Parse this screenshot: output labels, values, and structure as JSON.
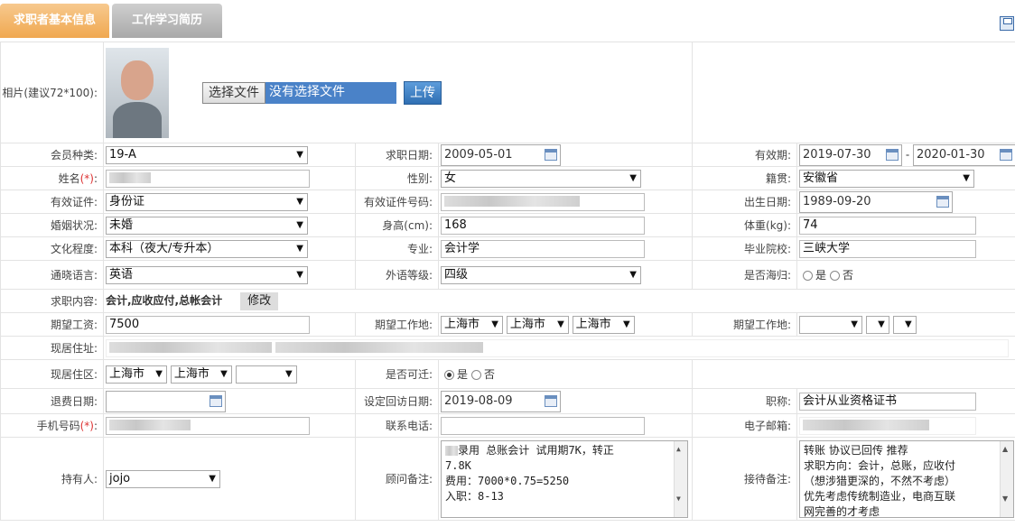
{
  "tabs": [
    {
      "label": "求职者基本信息",
      "active": true
    },
    {
      "label": "工作学习简历",
      "active": false
    }
  ],
  "photo": {
    "label": "相片(建议72*100):",
    "choose_label": "选择文件",
    "no_file_text": "没有选择文件",
    "upload_label": "上传"
  },
  "labels": {
    "member_type": "会员种类:",
    "job_date": "求职日期:",
    "valid_period": "有效期:",
    "name": "姓名",
    "name_req": "(*)",
    "name_colon": ":",
    "gender": "性别:",
    "native": "籍贯:",
    "id_type": "有效证件:",
    "id_no": "有效证件号码:",
    "birth": "出生日期:",
    "marital": "婚姻状况:",
    "height": "身高(cm):",
    "weight": "体重(kg):",
    "education": "文化程度:",
    "major": "专业:",
    "school": "毕业院校:",
    "language": "通晓语言:",
    "lang_level": "外语等级:",
    "overseas": "是否海归:",
    "job_content": "求职内容:",
    "modify": "修改",
    "salary": "期望工资:",
    "work_place1": "期望工作地:",
    "work_place2": "期望工作地:",
    "address": "现居住址:",
    "district": "现居住区:",
    "relocate": "是否可迁:",
    "refund_date": "退费日期:",
    "revisit_date": "设定回访日期:",
    "title": "职称:",
    "mobile": "手机号码",
    "mobile_req": "(*)",
    "mobile_colon": ":",
    "phone": "联系电话:",
    "email": "电子邮箱:",
    "holder": "持有人:",
    "consultant_note": "顾问备注:",
    "reception_note": "接待备注:",
    "yes": "是",
    "no": "否",
    "dash": "-"
  },
  "values": {
    "member_type": "19-A",
    "job_date": "2009-05-01",
    "valid_from": "2019-07-30",
    "valid_to": "2020-01-30",
    "gender": "女",
    "native": "安徽省",
    "id_type": "身份证",
    "birth": "1989-09-20",
    "marital": "未婚",
    "height": "168",
    "weight": "74",
    "education": "本科（夜大/专升本）",
    "major": "会计学",
    "school": "三峡大学",
    "language": "英语",
    "lang_level": "四级",
    "overseas": "",
    "job_content": "会计,应收应付,总帐会计",
    "salary": "7500",
    "work_place1": [
      "上海市",
      "上海市",
      "上海市"
    ],
    "work_place2": [
      "",
      "",
      ""
    ],
    "district": [
      "上海市",
      "上海市",
      ""
    ],
    "relocate": "是",
    "revisit_date": "2019-08-09",
    "title": "会计从业资格证书",
    "holder": "jojo",
    "consultant_note": [
      "录用 总账会计 试用期7K，转正",
      "7.8K",
      "费用：7000*0.75=5250",
      "入职：8-13"
    ],
    "reception_note": [
      "转账 协议已回传  推荐",
      "求职方向：会计，总账，应收付",
      "（想涉猎更深的，不然不考虑）",
      "优先考虑传统制造业，电商互联",
      "网完善的才考虑"
    ]
  }
}
